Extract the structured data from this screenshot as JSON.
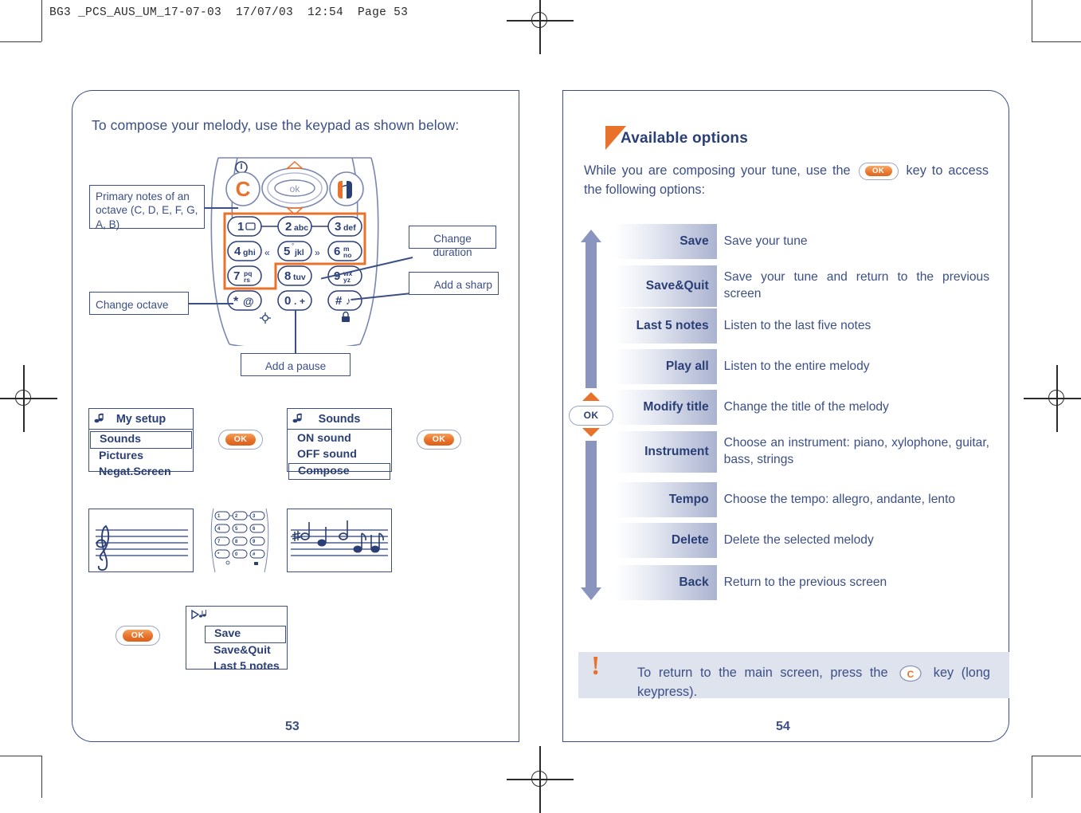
{
  "print_header": "BG3 _PCS_AUS_UM_17-07-03  17/07/03  12:54  Page 53",
  "left_page": {
    "number": "53",
    "lead": "To compose your melody, use the keypad as shown below:",
    "callouts": [
      {
        "name": "primary-notes",
        "text": "Primary notes of an octave (C, D, E, F, G, A, B)"
      },
      {
        "name": "change-duration",
        "text": "Change duration"
      },
      {
        "name": "add-sharp",
        "text": "Add a sharp"
      },
      {
        "name": "change-octave",
        "text": "Change octave"
      },
      {
        "name": "add-pause",
        "text": "Add a pause"
      }
    ],
    "keypad": {
      "soft_left": "C",
      "center": "ok",
      "keys": [
        {
          "digit": "1",
          "sub": ""
        },
        {
          "digit": "2",
          "sub": "abc"
        },
        {
          "digit": "3",
          "sub": "def"
        },
        {
          "digit": "4",
          "sub": "ghi"
        },
        {
          "digit": "5",
          "sub": "jkl"
        },
        {
          "digit": "6",
          "sub": "mno"
        },
        {
          "digit": "7",
          "sub": "pqrs"
        },
        {
          "digit": "8",
          "sub": "tuv"
        },
        {
          "digit": "9",
          "sub": "wxyz"
        },
        {
          "digit": "*",
          "sub": "@"
        },
        {
          "digit": "0",
          "sub": ".+"
        },
        {
          "digit": "#",
          "sub": ""
        }
      ]
    },
    "screens": [
      {
        "name": "my-setup",
        "title": "My setup",
        "items": [
          "Sounds",
          "Pictures",
          "Negat.Screen"
        ],
        "selected": "Sounds"
      },
      {
        "name": "sounds",
        "title": "Sounds",
        "items": [
          "ON sound",
          "OFF sound",
          "Compose"
        ],
        "selected": "Compose"
      },
      {
        "name": "compose-options",
        "title": "",
        "items": [
          "Save",
          "Save&Quit",
          "Last 5 notes"
        ],
        "selected": "Save"
      }
    ],
    "ok_label": "OK"
  },
  "right_page": {
    "number": "54",
    "section_title": "Available options",
    "intro_before": "While you are composing your tune, use the",
    "intro_after": "key to access the following options:",
    "ok_label": "OK",
    "options": [
      {
        "label": "Save",
        "desc": "Save your tune"
      },
      {
        "label": "Save&Quit",
        "desc": "Save your tune and return to the previous screen"
      },
      {
        "label": "Last 5 notes",
        "desc": "Listen to the last five notes"
      },
      {
        "label": "Play all",
        "desc": "Listen to the entire melody"
      },
      {
        "label": "Modify title",
        "desc": "Change the title of the melody"
      },
      {
        "label": "Instrument",
        "desc": "Choose an instrument: piano, xylophone, guitar, bass, strings"
      },
      {
        "label": "Tempo",
        "desc": "Choose the tempo: allegro, andante, lento"
      },
      {
        "label": "Delete",
        "desc": "Delete the selected melody"
      },
      {
        "label": "Back",
        "desc": "Return to the previous screen"
      }
    ],
    "note": {
      "bang": "!",
      "text_before": "To return to the main screen, press the",
      "key": "C",
      "text_after": "key (long keypress)."
    }
  },
  "colors": {
    "ink_blue": "#3c4f86",
    "deep_blue": "#2b3f77",
    "accent_orange": "#e8722a",
    "row_gradient_end": "#aab3d0",
    "note_bg": "#dfe3ee"
  }
}
